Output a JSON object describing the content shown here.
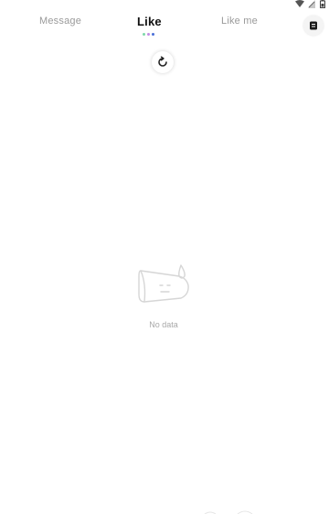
{
  "status_bar": {
    "icons": [
      "wifi-icon",
      "signal-icon",
      "battery-icon"
    ]
  },
  "tabs": [
    {
      "label": "Message",
      "active": false
    },
    {
      "label": "Like",
      "active": true
    },
    {
      "label": "Like me",
      "active": false
    }
  ],
  "indicator_colors": [
    "#7ed9a9",
    "#c48be6",
    "#4a6fd8"
  ],
  "toolbar": {
    "filter_icon": "filter-icon",
    "refresh_icon": "refresh-icon"
  },
  "empty_state": {
    "icon": "empty-cup-icon",
    "text": "No data"
  }
}
